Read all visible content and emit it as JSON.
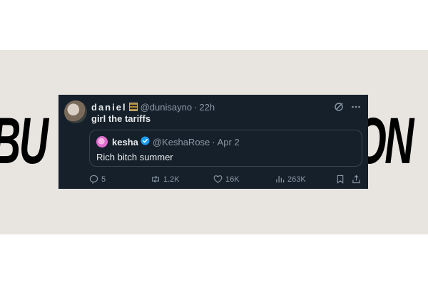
{
  "background": {
    "left_word": "BU",
    "right_word": "ON",
    "band_color": "#e8e5e1"
  },
  "tweet": {
    "display_name": "daniel",
    "handle": "@dunisayno",
    "separator": "·",
    "time": "22h",
    "text": "girl the tariffs",
    "header_icons": [
      "grok-icon",
      "more-icon"
    ],
    "quote": {
      "display_name": "kesha",
      "handle": "@KeshaRose",
      "separator": "·",
      "date": "Apr 2",
      "text": "Rich bitch summer",
      "verified": true
    },
    "actions": {
      "replies": "5",
      "retweets": "1.2K",
      "likes": "16K",
      "views": "263K"
    },
    "colors": {
      "card_bg": "#15202b",
      "text": "#e7e9ea",
      "muted": "#8b98a5",
      "border": "#38444d",
      "verified_blue": "#1d9bf0"
    }
  }
}
